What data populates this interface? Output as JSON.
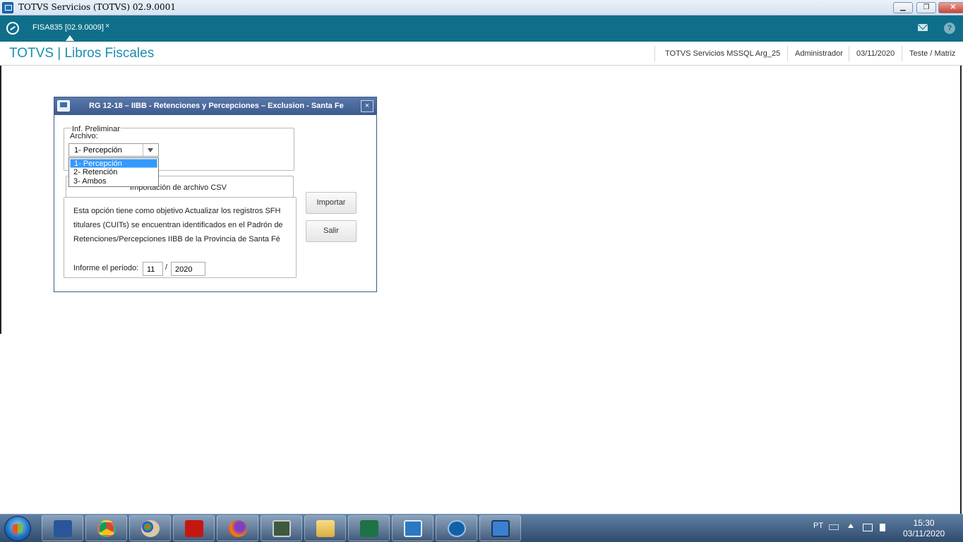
{
  "window": {
    "title": "TOTVS Servicios (TOTVS) 02.9.0001",
    "minimize": "▁",
    "restore": "❐",
    "close": "✕"
  },
  "tabbar": {
    "tab_label": "FISA835 [02.9.0009]",
    "tab_close": "×",
    "help": "?"
  },
  "header": {
    "app_name": "TOTVS | Libros Fiscales",
    "environment": "TOTVS Servicios MSSQL Arg_25",
    "user": "Administrador",
    "date": "03/11/2020",
    "company": "Teste / Matriz"
  },
  "dialog": {
    "title": "RG 12-18 – IIBB - Retenciones y Percepciones – Exclusion - Santa Fe",
    "close": "×",
    "group_label": "Inf. Preliminar",
    "archivo_label": "Archivo:",
    "combo_value": "1- Percepción",
    "options": [
      "1- Percepción",
      "2- Retención",
      "3- Ambos"
    ],
    "csv_label": "Importación de archivo CSV",
    "description": [
      "Esta opción tiene como objetivo Actualizar los registros SFH",
      "titulares (CUITs) se encuentran identificados en el Padrón de",
      "Retenciones/Percepciones IIBB de la Provincia de Santa Fé"
    ],
    "period_label": "Informe el período:",
    "period_month": "11",
    "period_sep": "/",
    "period_year": "2020",
    "import_button": "Importar",
    "exit_button": "Salir"
  },
  "taskbar": {
    "language": "PT",
    "time": "15:30",
    "date": "03/11/2020",
    "apps": [
      "word-icon",
      "chrome-icon",
      "paint-icon",
      "acrobat-icon",
      "firefox-icon",
      "monitor-icon",
      "explorer-icon",
      "excel-icon",
      "remote-icon",
      "app-store-icon",
      "totvs-icon"
    ]
  },
  "colors": {
    "teal": "#0f6f8a",
    "brand_text": "#1a8db0",
    "dialog_title": "#3c5a8d",
    "selection": "#3399ff"
  }
}
